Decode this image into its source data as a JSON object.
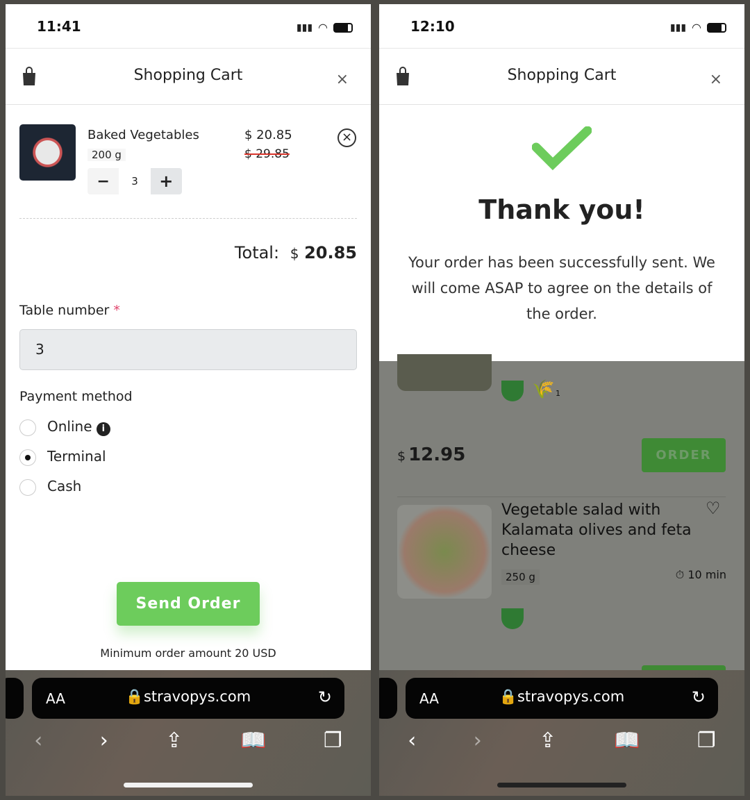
{
  "left": {
    "status": {
      "time": "11:41"
    },
    "header": {
      "title": "Shopping Cart",
      "close": "×"
    },
    "cart_item": {
      "name": "Baked Vegetables",
      "weight": "200 g",
      "price": "$ 20.85",
      "old_price": "$ 29.85",
      "quantity": "3",
      "minus": "−",
      "plus": "+"
    },
    "total": {
      "label": "Total:",
      "currency": "$",
      "amount": "20.85"
    },
    "table": {
      "label": "Table number",
      "required": "*",
      "value": "3"
    },
    "payment": {
      "label": "Payment method",
      "options": [
        {
          "label": "Online",
          "selected": false
        },
        {
          "label": "Terminal",
          "selected": true
        },
        {
          "label": "Cash",
          "selected": false
        }
      ]
    },
    "send_button": "Send Order",
    "min_order": "Minimum order amount 20 USD",
    "browser": {
      "aa": "AA",
      "url": "stravopys.com"
    }
  },
  "right": {
    "status": {
      "time": "12:10"
    },
    "header": {
      "title": "Shopping Cart",
      "close": "×"
    },
    "modal": {
      "title": "Thank you!",
      "message": "Your order has been successfully sent. We will come ASAP to agree on the details of the order."
    },
    "menu": {
      "gluten_count": "1",
      "price_currency": "$",
      "price": "12.95",
      "order_button": "ORDER",
      "item": {
        "name": "Vegetable salad with Kalamata olives and feta cheese",
        "weight": "250 g",
        "time": "10 min"
      }
    },
    "browser": {
      "aa": "AA",
      "url": "stravopys.com"
    }
  },
  "colors": {
    "accent": "#6dcc5c",
    "strike": "#d9352b",
    "required": "#e0436b"
  }
}
